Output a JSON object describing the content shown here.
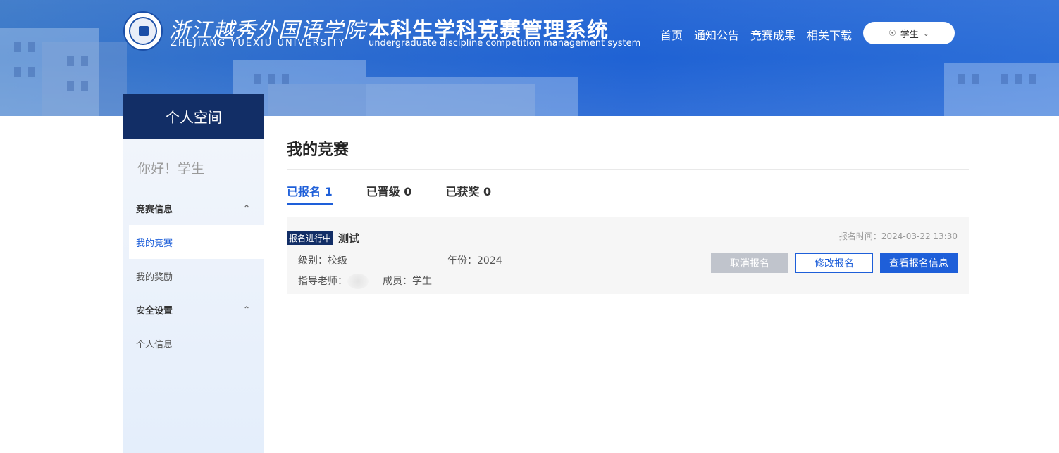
{
  "header": {
    "school_name_cn": "浙江越秀外国语学院",
    "school_name_en": "ZHEJIANG  YUEXIU  UNIVERSITY",
    "system_name_cn": "本科生学科竞赛管理系统",
    "system_name_en": "undergraduate discipline competition management system",
    "nav": [
      "首页",
      "通知公告",
      "竞赛成果",
      "相关下载"
    ],
    "user_label": "学生"
  },
  "sidebar": {
    "title": "个人空间",
    "greeting": "你好！学生",
    "groups": [
      {
        "label": "竞赛信息",
        "items": [
          "我的竞赛",
          "我的奖励"
        ]
      },
      {
        "label": "安全设置",
        "items": [
          "个人信息"
        ]
      }
    ],
    "active_item": "我的竞赛"
  },
  "main": {
    "title": "我的竞赛",
    "tabs": [
      {
        "label": "已报名 1",
        "active": true
      },
      {
        "label": "已晋级 0",
        "active": false
      },
      {
        "label": "已获奖 0",
        "active": false
      }
    ],
    "card": {
      "status_badge": "报名进行中",
      "name": "测试",
      "registration_time": "报名时间：2024-03-22 13:30",
      "level": "级别：校级",
      "year": "年份：2024",
      "advisor_label": "指导老师：",
      "members": "成员：学生",
      "buttons": {
        "cancel": "取消报名",
        "modify": "修改报名",
        "view": "查看报名信息"
      }
    }
  },
  "colors": {
    "primary": "#1e5fd9",
    "navy": "#122e66",
    "disabled": "#c0c4cc"
  }
}
